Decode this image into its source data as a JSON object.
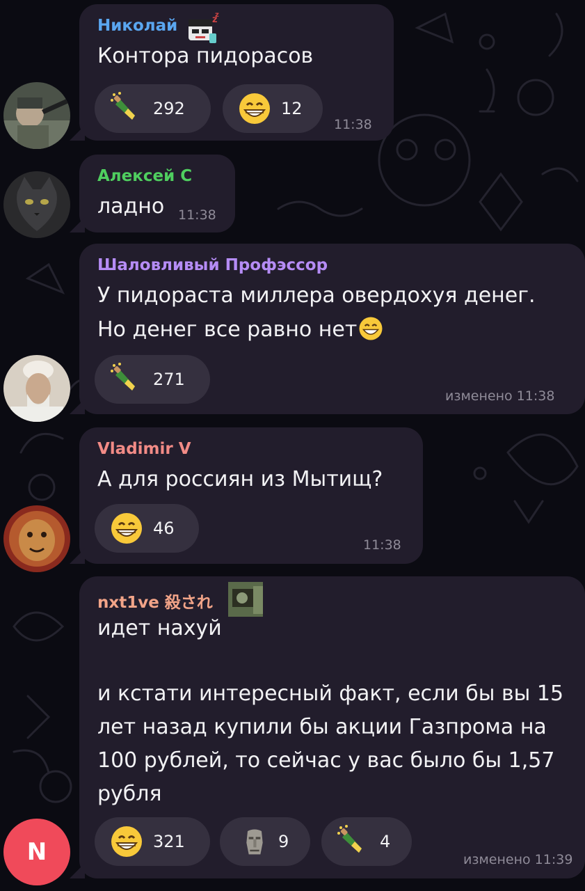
{
  "colors": {
    "bubble": "#221d2c",
    "reaction_pill": "#35303f",
    "timestamp": "#8f8b98",
    "name_nikolai": "#5aa6f0",
    "name_aleksei": "#4fce5f",
    "name_professor": "#b58cf5",
    "name_vladimir": "#f28b86",
    "name_nxt1ve": "#f2a488"
  },
  "messages": [
    {
      "sender": "Николай",
      "text": "Контора пидорасов",
      "time": "11:38",
      "reactions": [
        {
          "icon": "champagne-icon",
          "count": "292"
        },
        {
          "icon": "grinning-face-icon",
          "count": "12"
        }
      ]
    },
    {
      "sender": "Алексей С",
      "text": "ладно",
      "time": "11:38"
    },
    {
      "sender": "Шаловливый Профэссор",
      "lines": [
        "У пидораста миллера овердохуя денег.",
        "Но денег все равно нет"
      ],
      "time": "изменено 11:38",
      "reactions": [
        {
          "icon": "champagne-icon",
          "count": "271"
        }
      ]
    },
    {
      "sender": "Vladimir V",
      "text": "А для россиян из Мытищ?",
      "time": "11:38",
      "reactions": [
        {
          "icon": "grinning-face-icon",
          "count": "46"
        }
      ]
    },
    {
      "sender": "nxt1ve 殺され",
      "lines": [
        "идет нахуй",
        "",
        "и кстати интересный факт, если бы вы 15",
        "лет назад купили бы акции Газпрома на",
        "100 рублей, то сейчас у вас было бы 1,57",
        "рубля"
      ],
      "time": "изменено 11:39",
      "avatar_letter": "N",
      "reactions": [
        {
          "icon": "grinning-face-icon",
          "count": "321"
        },
        {
          "icon": "moai-icon",
          "count": "9"
        },
        {
          "icon": "champagne-icon",
          "count": "4"
        }
      ]
    }
  ]
}
